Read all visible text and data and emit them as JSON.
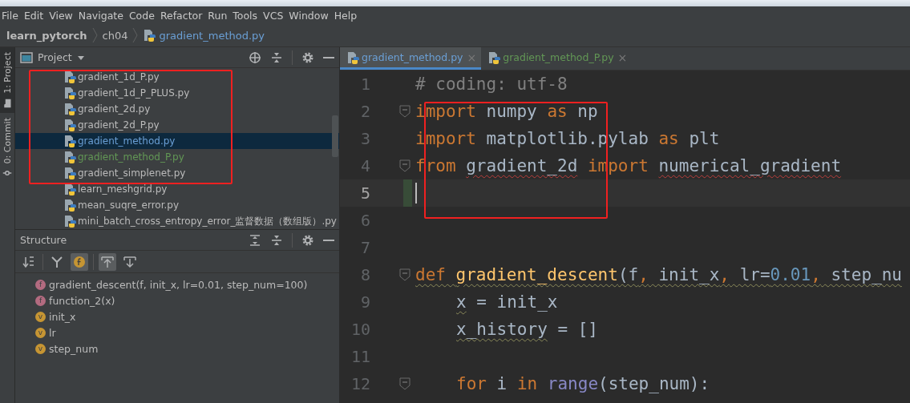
{
  "menu_bar": {
    "items": [
      {
        "label": "File"
      },
      {
        "label": "Edit"
      },
      {
        "label": "View"
      },
      {
        "label": "Navigate"
      },
      {
        "label": "Code"
      },
      {
        "label": "Refactor"
      },
      {
        "label": "Run"
      },
      {
        "label": "Tools"
      },
      {
        "label": "VCS"
      },
      {
        "label": "Window"
      },
      {
        "label": "Help"
      }
    ]
  },
  "breadcrumb": [
    {
      "label": "learn_pytorch",
      "kind": "project"
    },
    {
      "label": "ch04",
      "kind": "folder"
    },
    {
      "label": "gradient_method.py",
      "kind": "file"
    }
  ],
  "tool_stripe": [
    {
      "label": "1: Project",
      "selected": true
    },
    {
      "label": "0: Commit",
      "selected": false
    }
  ],
  "project_panel": {
    "title": "Project",
    "files": [
      {
        "name": "gradient_1d_P.py",
        "modified": false,
        "added": false,
        "selected": false
      },
      {
        "name": "gradient_1d_P_PLUS.py",
        "modified": false,
        "added": false,
        "selected": false
      },
      {
        "name": "gradient_2d.py",
        "modified": false,
        "added": false,
        "selected": false
      },
      {
        "name": "gradient_2d_P.py",
        "modified": false,
        "added": false,
        "selected": false
      },
      {
        "name": "gradient_method.py",
        "modified": true,
        "added": false,
        "selected": true
      },
      {
        "name": "gradient_method_P.py",
        "modified": false,
        "added": true,
        "selected": false
      },
      {
        "name": "gradient_simplenet.py",
        "modified": false,
        "added": false,
        "selected": false
      },
      {
        "name": "learn_meshgrid.py",
        "modified": false,
        "added": false,
        "selected": false
      },
      {
        "name": "mean_suqre_error.py",
        "modified": false,
        "added": false,
        "selected": false
      },
      {
        "name": "mini_batch_cross_entropy_error_监督数据（数组版）.py",
        "modified": false,
        "added": false,
        "selected": false
      }
    ]
  },
  "project_highlight": {
    "shown": true
  },
  "structure_panel": {
    "title": "Structure",
    "toolbar": [
      {
        "kind": "sort",
        "selected": false
      },
      {
        "kind": "divider"
      },
      {
        "kind": "fields",
        "selected": false
      },
      {
        "kind": "functions",
        "selected": true
      },
      {
        "kind": "divider"
      },
      {
        "kind": "autoscroll_to",
        "selected": true
      },
      {
        "kind": "autoscroll_from",
        "selected": false
      }
    ],
    "items": [
      {
        "kind": "function",
        "badge": "f",
        "label": "gradient_descent(f, init_x, lr=0.01, step_num=100)"
      },
      {
        "kind": "function",
        "badge": "f",
        "label": "function_2(x)"
      },
      {
        "kind": "variable",
        "badge": "v",
        "label": "init_x"
      },
      {
        "kind": "variable",
        "badge": "v",
        "label": "lr"
      },
      {
        "kind": "variable",
        "badge": "v",
        "label": "step_num"
      }
    ]
  },
  "editor": {
    "highlight": {
      "shown": true
    },
    "tabs": [
      {
        "label": "gradient_method.py",
        "modified": true,
        "added": false,
        "selected": true,
        "close": "×"
      },
      {
        "label": "gradient_method_P.py",
        "modified": false,
        "added": true,
        "selected": false,
        "close": "×"
      }
    ],
    "lines": [
      {
        "number": "1",
        "fold": false,
        "current": false,
        "changed": false,
        "indented": false,
        "tokens": [
          {
            "t": "# coding: utf-8",
            "kind": "comment"
          }
        ]
      },
      {
        "number": "2",
        "fold": true,
        "current": false,
        "changed": false,
        "indented": false,
        "tokens": [
          {
            "t": "import",
            "kind": "keyword"
          },
          {
            "t": " numpy ",
            "kind": "plain"
          },
          {
            "t": "as",
            "kind": "keyword"
          },
          {
            "t": " np",
            "kind": "plain"
          }
        ]
      },
      {
        "number": "3",
        "fold": false,
        "current": false,
        "changed": false,
        "indented": false,
        "tokens": [
          {
            "t": "import",
            "kind": "keyword"
          },
          {
            "t": " matplotlib.pylab ",
            "kind": "plain"
          },
          {
            "t": "as",
            "kind": "keyword"
          },
          {
            "t": " plt",
            "kind": "plain"
          }
        ]
      },
      {
        "number": "4",
        "fold": true,
        "current": false,
        "changed": false,
        "indented": false,
        "tokens": [
          {
            "t": "from ",
            "kind": "keyword"
          },
          {
            "t": "gradient_2d",
            "kind": "plain",
            "typo": true
          },
          {
            "t": " import ",
            "kind": "keyword"
          },
          {
            "t": "numerical_gradient",
            "kind": "plain",
            "typo": true
          }
        ]
      },
      {
        "number": "5",
        "fold": false,
        "current": true,
        "changed": true
      },
      {
        "number": "6",
        "fold": false,
        "current": false,
        "changed": false
      },
      {
        "number": "7",
        "fold": false,
        "current": false,
        "changed": false
      },
      {
        "number": "8",
        "fold": true,
        "current": false,
        "changed": false,
        "indented": false,
        "tokens": [
          {
            "t": "def ",
            "kind": "keyword",
            "warning": true
          },
          {
            "t": "gradient_descent",
            "kind": "func",
            "warning": true
          },
          {
            "t": "(f",
            "kind": "plain",
            "warning": true
          },
          {
            "t": ",",
            "kind": "keyword",
            "warning": true
          },
          {
            "t": " init_x",
            "kind": "plain",
            "warning": true
          },
          {
            "t": ",",
            "kind": "keyword",
            "warning": true
          },
          {
            "t": " lr=",
            "kind": "plain",
            "warning": true
          },
          {
            "t": "0.01",
            "kind": "number",
            "warning": true
          },
          {
            "t": ",",
            "kind": "keyword",
            "warning": true
          },
          {
            "t": " step_nu",
            "kind": "plain",
            "warning": true
          }
        ]
      },
      {
        "number": "9",
        "fold": false,
        "current": false,
        "changed": false,
        "indented": true,
        "tokens": [
          {
            "t": "x",
            "kind": "plain",
            "warning": true
          },
          {
            "t": " = init_x",
            "kind": "plain"
          }
        ]
      },
      {
        "number": "10",
        "fold": false,
        "current": false,
        "changed": false,
        "indented": true,
        "tokens": [
          {
            "t": "x_history",
            "kind": "plain",
            "warning": true
          },
          {
            "t": " = []",
            "kind": "plain"
          }
        ]
      },
      {
        "number": "11",
        "fold": false,
        "current": false,
        "changed": false
      },
      {
        "number": "12",
        "fold": true,
        "current": false,
        "changed": false,
        "indented": true,
        "tokens": [
          {
            "t": "for",
            "kind": "keyword"
          },
          {
            "t": " i ",
            "kind": "plain"
          },
          {
            "t": "in",
            "kind": "keyword"
          },
          {
            "t": " range",
            "kind": "builtin"
          },
          {
            "t": "(step_num):",
            "kind": "plain"
          }
        ]
      }
    ]
  }
}
